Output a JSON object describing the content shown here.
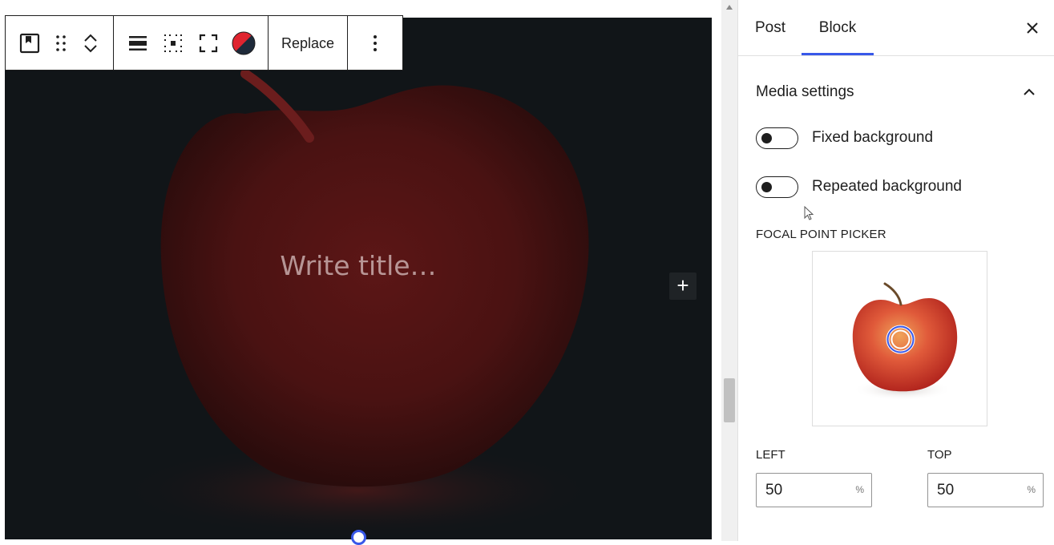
{
  "toolbar": {
    "replace_label": "Replace",
    "icons": [
      "cover-block-icon",
      "drag-handle-icon",
      "move-up-icon",
      "move-down-icon",
      "align-full-width-icon",
      "content-position-icon",
      "fullscreen-icon",
      "overlay-color-icon",
      "more-options-icon"
    ]
  },
  "cover": {
    "title_placeholder": "Write title…",
    "background_color": "#111518",
    "accent_color": "#6b1a1a"
  },
  "sidebar": {
    "tabs": [
      {
        "label": "Post",
        "active": false
      },
      {
        "label": "Block",
        "active": true
      }
    ],
    "panel": {
      "title": "Media settings",
      "fixed_background": {
        "label": "Fixed background",
        "checked": false
      },
      "repeated_background": {
        "label": "Repeated background",
        "checked": false
      },
      "focal_point_label": "FOCAL POINT PICKER",
      "left": {
        "label": "LEFT",
        "value": "50",
        "unit": "%"
      },
      "top": {
        "label": "TOP",
        "value": "50",
        "unit": "%"
      }
    },
    "accent_color": "#3858e9"
  }
}
